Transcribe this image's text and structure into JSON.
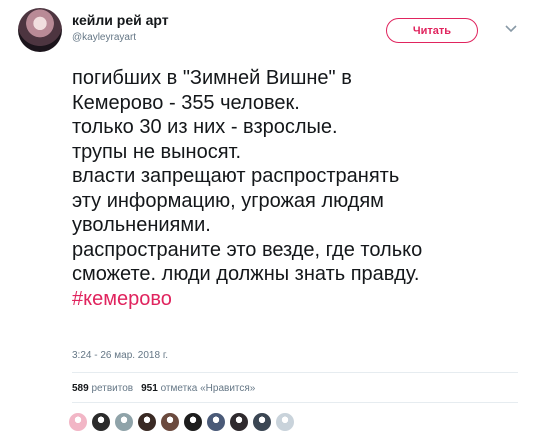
{
  "account": {
    "display_name": "кейли рей арт",
    "handle": "@kayleyrayart",
    "avatar_icon": "profile-avatar"
  },
  "header": {
    "follow_label": "Читать",
    "menu_icon": "chevron-down-icon"
  },
  "tweet": {
    "lines": [
      "погибших в \"Зимней Вишне\" в",
      "Кемерово - 355 человек.",
      "только 30 из них - взрослые.",
      "трупы не выносят.",
      "власти запрещают распространять",
      "эту информацию, угрожая людям",
      "увольнениями.",
      "распространите это везде, где только",
      "сможете. люди должны знать правду."
    ],
    "hashtag": "#кемерово",
    "timestamp": "3:24 - 26 мар. 2018 г."
  },
  "stats": {
    "retweets_count": "589",
    "retweets_label": "ретвитов",
    "likes_count": "951",
    "likes_label": "отметка «Нравится»"
  },
  "likers": [
    {
      "name": "liker-avatar-1",
      "color": "#f2b6c6"
    },
    {
      "name": "liker-avatar-2",
      "color": "#2b2b2b"
    },
    {
      "name": "liker-avatar-3",
      "color": "#8fa3a9"
    },
    {
      "name": "liker-avatar-4",
      "color": "#3a2a24"
    },
    {
      "name": "liker-avatar-5",
      "color": "#6b4a3e"
    },
    {
      "name": "liker-avatar-6",
      "color": "#1d1d1d"
    },
    {
      "name": "liker-avatar-7",
      "color": "#4a5a78"
    },
    {
      "name": "liker-avatar-8",
      "color": "#2f2a2e"
    },
    {
      "name": "liker-avatar-9",
      "color": "#3b4653"
    },
    {
      "name": "liker-avatar-10",
      "color": "#c9d3db"
    }
  ],
  "colors": {
    "accent": "#e0245e",
    "text": "#14171a",
    "secondary": "#657786"
  }
}
